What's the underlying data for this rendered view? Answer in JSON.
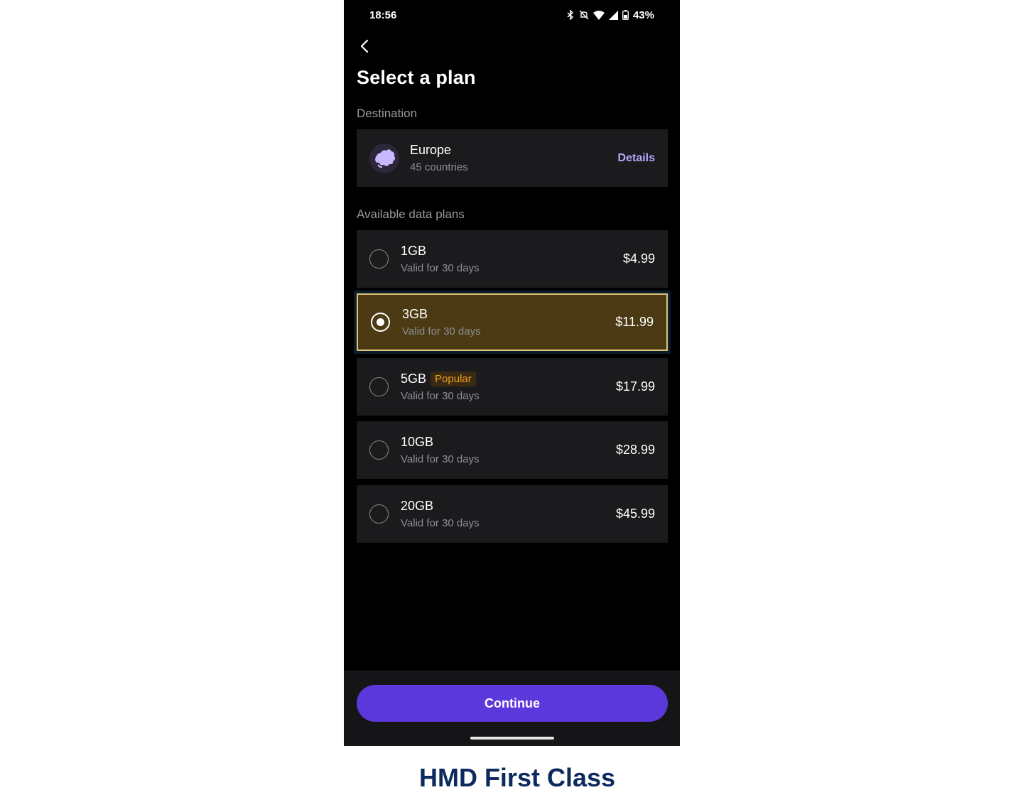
{
  "status_bar": {
    "time": "18:56",
    "battery": "43%",
    "icons": [
      "bluetooth-icon",
      "mute-icon",
      "wifi-icon",
      "signal-icon",
      "battery-icon"
    ]
  },
  "header": {
    "back_icon": "chevron-left-icon",
    "title": "Select a plan"
  },
  "destination": {
    "section_label": "Destination",
    "name": "Europe",
    "subtitle": "45 countries",
    "details_label": "Details",
    "icon": "europe-globe-icon"
  },
  "plans": {
    "section_label": "Available data plans",
    "items": [
      {
        "name": "1GB",
        "validity": "Valid for 30 days",
        "price": "$4.99",
        "selected": false
      },
      {
        "name": "3GB",
        "validity": "Valid for 30 days",
        "price": "$11.99",
        "selected": true
      },
      {
        "name": "5GB",
        "validity": "Valid for 30 days",
        "price": "$17.99",
        "selected": false,
        "badge": "Popular"
      },
      {
        "name": "10GB",
        "validity": "Valid for 30 days",
        "price": "$28.99",
        "selected": false
      },
      {
        "name": "20GB",
        "validity": "Valid for 30 days",
        "price": "$45.99",
        "selected": false
      }
    ]
  },
  "footer": {
    "continue_label": "Continue"
  },
  "caption": "HMD First Class",
  "colors": {
    "accent": "#5b38dc",
    "selected_bg": "#4b3a14",
    "link": "#b8a8ff",
    "badge": "#f0a020",
    "caption": "#0d2a5e"
  }
}
